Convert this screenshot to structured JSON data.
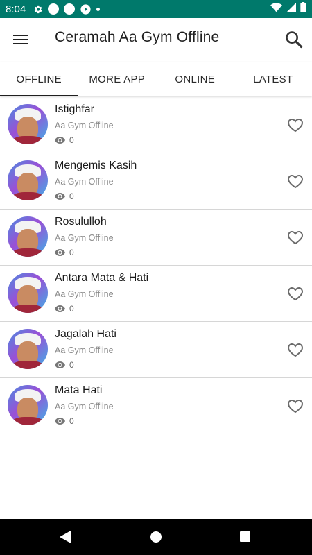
{
  "status_bar": {
    "time": "8:04",
    "colors": {
      "background": "#00796b"
    },
    "icons": [
      "gear-icon",
      "circle-icon",
      "circle-icon",
      "cast-icon",
      "dot-icon",
      "wifi-icon",
      "signal-icon",
      "battery-icon"
    ]
  },
  "app_bar": {
    "title": "Ceramah Aa Gym Offline",
    "menu_icon": "hamburger-menu-icon",
    "search_icon": "search-icon"
  },
  "tabs": [
    {
      "label": "OFFLINE",
      "active": true
    },
    {
      "label": "MORE APP",
      "active": false
    },
    {
      "label": "ONLINE",
      "active": false
    },
    {
      "label": "LATEST",
      "active": false
    }
  ],
  "items": [
    {
      "title": "Istighfar",
      "subtitle": "Aa Gym Offline",
      "views": "0"
    },
    {
      "title": "Mengemis Kasih",
      "subtitle": "Aa Gym Offline",
      "views": "0"
    },
    {
      "title": "Rosululloh",
      "subtitle": "Aa Gym Offline",
      "views": "0"
    },
    {
      "title": "Antara Mata & Hati",
      "subtitle": "Aa Gym Offline",
      "views": "0"
    },
    {
      "title": "Jagalah Hati",
      "subtitle": "Aa Gym Offline",
      "views": "0"
    },
    {
      "title": "Mata Hati",
      "subtitle": "Aa Gym Offline",
      "views": "0"
    }
  ],
  "nav_bar": {
    "icons": [
      "back-icon",
      "home-icon",
      "recents-icon"
    ]
  }
}
